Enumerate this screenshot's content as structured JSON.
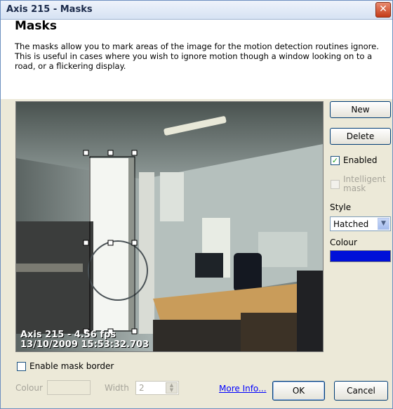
{
  "window": {
    "title": "Axis 215 - Masks",
    "close_symbol": "✕"
  },
  "header": {
    "heading": "Masks",
    "description": "The masks allow you to mark areas of the image for the motion detection routines ignore. This is useful in cases where you wish to ignore motion though a window looking on to a road, or a flickering display."
  },
  "camera": {
    "overlay_line1": "Axis 215 - 4.56 fps",
    "overlay_line2": "13/10/2009 15:53:32.703"
  },
  "side": {
    "new_label": "New",
    "delete_label": "Delete",
    "enabled_label": "Enabled",
    "enabled_checked": true,
    "intelligent_label_1": "Intelligent",
    "intelligent_label_2": "mask",
    "style_label": "Style",
    "style_value": "Hatched",
    "colour_label": "Colour",
    "colour_value": "#0010d8"
  },
  "bottom": {
    "enable_border_label": "Enable mask border",
    "colour_label": "Colour",
    "width_label": "Width",
    "width_value": "2",
    "more_info_label": "More Info...",
    "ok_label": "OK",
    "cancel_label": "Cancel"
  }
}
